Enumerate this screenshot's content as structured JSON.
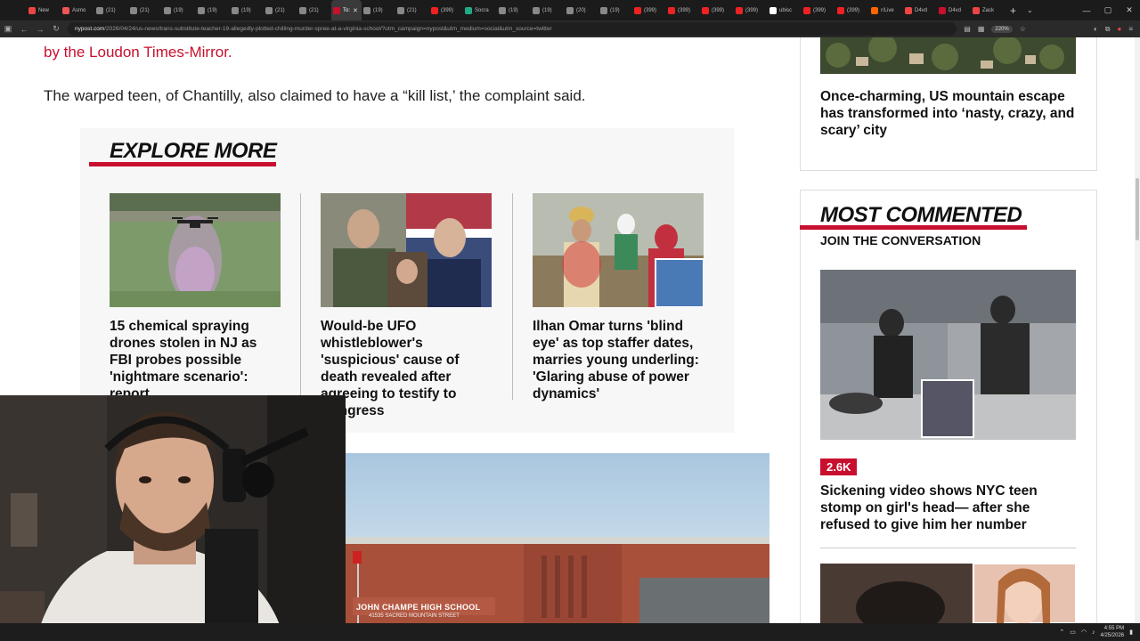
{
  "browser": {
    "tabs": [
      {
        "label": "New",
        "color": "#e44"
      },
      {
        "label": "Asmo",
        "color": "#e55"
      },
      {
        "label": "(21)",
        "color": "#888"
      },
      {
        "label": "(21)",
        "color": "#888"
      },
      {
        "label": "(19)",
        "color": "#888"
      },
      {
        "label": "(19)",
        "color": "#888"
      },
      {
        "label": "(19)",
        "color": "#888"
      },
      {
        "label": "(21)",
        "color": "#888"
      },
      {
        "label": "(21)",
        "color": "#888"
      },
      {
        "label": "To:",
        "color": "#c8102e",
        "active": true
      },
      {
        "label": "(19)",
        "color": "#888"
      },
      {
        "label": "(21)",
        "color": "#888"
      },
      {
        "label": "(399)",
        "color": "#e22"
      },
      {
        "label": "Socra",
        "color": "#2a8"
      },
      {
        "label": "(19)",
        "color": "#888"
      },
      {
        "label": "(19)",
        "color": "#888"
      },
      {
        "label": "(20)",
        "color": "#888"
      },
      {
        "label": "(19)",
        "color": "#888"
      },
      {
        "label": "(399)",
        "color": "#e22"
      },
      {
        "label": "(399)",
        "color": "#e22"
      },
      {
        "label": "(399)",
        "color": "#e22"
      },
      {
        "label": "(399)",
        "color": "#e22"
      },
      {
        "label": "ubisc",
        "color": "#fff"
      },
      {
        "label": "(399)",
        "color": "#e22"
      },
      {
        "label": "(399)",
        "color": "#e22"
      },
      {
        "label": "r/Live",
        "color": "#f60"
      },
      {
        "label": "D4vd",
        "color": "#e44"
      },
      {
        "label": "D4vd",
        "color": "#c8102e"
      },
      {
        "label": "Zack",
        "color": "#e44"
      }
    ],
    "url_host": "nypost.com",
    "url_path": "/2026/04/24/us-news/trans-substitute-teacher-19-allegedly-plotted-chilling-murder-spree-at-a-virginia-school/?utm_campaign=nypost&utm_medium=social&utm_source=twitter",
    "zoom": "220%"
  },
  "article": {
    "link_text": "by the Loudon Times-Mirror.",
    "paragraph": "The warped teen, of Chantilly, also claimed to have a “kill list,’ the complaint said."
  },
  "explore": {
    "title": "EXPLORE MORE",
    "cards": [
      {
        "headline": "15 chemical spraying drones stolen in NJ as FBI probes possible 'nightmare scenario': report"
      },
      {
        "headline": "Would-be UFO whistleblower's 'suspicious' cause of death revealed after agreeing to testify to Congress"
      },
      {
        "headline": "Ilhan Omar turns 'blind eye' as top staffer dates, marries young underling: 'Glaring abuse of power dynamics'"
      }
    ]
  },
  "school_image": {
    "sign_text": "JOHN CHAMPE HIGH SCHOOL",
    "sign_sub": "41535 SACRED MOUNTAIN STREET"
  },
  "sidebar": {
    "top_story": "Once-charming, US mountain escape has transformed into ‘nasty, crazy, and scary’ city",
    "most_commented_title": "MOST COMMENTED",
    "most_commented_sub": "JOIN THE CONVERSATION",
    "comment_count": "2.6K",
    "story": "Sickening video shows NYC teen stomp on girl's head— after she refused to give him her number"
  },
  "taskbar": {
    "time": "4:55 PM",
    "date": "4/25/2026"
  },
  "colors": {
    "brand_red": "#c8102e"
  }
}
